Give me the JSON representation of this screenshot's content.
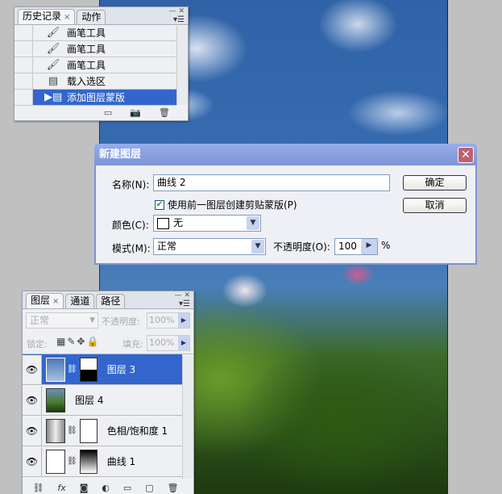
{
  "history_panel": {
    "tabs": [
      {
        "label": "历史记录",
        "active": true
      },
      {
        "label": "动作",
        "active": false
      }
    ],
    "items": [
      {
        "icon": "brush-icon",
        "label": "画笔工具",
        "selected": false
      },
      {
        "icon": "brush-icon",
        "label": "画笔工具",
        "selected": false
      },
      {
        "icon": "brush-icon",
        "label": "画笔工具",
        "selected": false
      },
      {
        "icon": "document-icon",
        "label": "载入选区",
        "selected": false
      },
      {
        "icon": "document-icon",
        "label": "添加图层蒙版",
        "selected": true
      }
    ],
    "tab_close": "×"
  },
  "dialog": {
    "title": "新建图层",
    "close": "✕",
    "name_label": "名称(N):",
    "name_value": "曲线 2",
    "clip_checkbox_label": "使用前一图层创建剪贴蒙版(P)",
    "clip_checked": true,
    "color_label": "颜色(C):",
    "color_value": "无",
    "mode_label": "模式(M):",
    "mode_value": "正常",
    "opacity_label": "不透明度(O):",
    "opacity_value": "100",
    "opacity_unit": "%",
    "ok": "确定",
    "cancel": "取消"
  },
  "layers_panel": {
    "tabs": [
      {
        "label": "图层",
        "active": true
      },
      {
        "label": "通道",
        "active": false
      },
      {
        "label": "路径",
        "active": false
      }
    ],
    "tab_close": "×",
    "blend_mode": "正常",
    "opacity_label": "不透明度:",
    "opacity_value": "100%",
    "lock_label": "锁定:",
    "fill_label": "填充:",
    "fill_value": "100%",
    "layers": [
      {
        "name": "图层 3",
        "selected": true,
        "has_mask": true
      },
      {
        "name": "图层 4",
        "selected": false,
        "has_mask": false
      },
      {
        "name": "色相/饱和度 1",
        "selected": false,
        "has_mask": true
      },
      {
        "name": "曲线 1",
        "selected": false,
        "has_mask": true
      }
    ]
  }
}
